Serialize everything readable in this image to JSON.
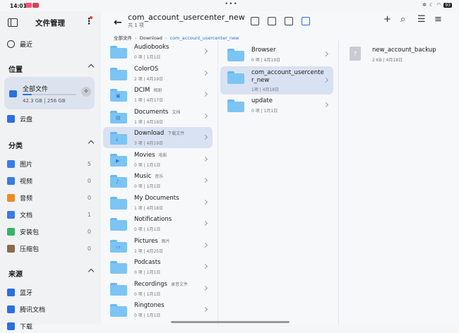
{
  "status": {
    "time": "14:01",
    "battery": "93"
  },
  "app_title": "文件管理",
  "nav": {
    "recent": "最近"
  },
  "location": {
    "heading": "位置",
    "all_files": {
      "label": "全部文件",
      "size": "42.3 GB | 256 GB",
      "used_fraction": 0.165
    },
    "cloud": "云盘"
  },
  "categories": {
    "heading": "分类",
    "items": [
      {
        "label": "图片",
        "count": "5",
        "color": "#3a7be8"
      },
      {
        "label": "视频",
        "count": "0",
        "color": "#3a7be8"
      },
      {
        "label": "音频",
        "count": "0",
        "color": "#f08a24"
      },
      {
        "label": "文档",
        "count": "1",
        "color": "#3a7be8"
      },
      {
        "label": "安装包",
        "count": "0",
        "color": "#36b46a"
      },
      {
        "label": "压缩包",
        "count": "0",
        "color": "#8b6b4a"
      }
    ]
  },
  "sources": {
    "heading": "来源",
    "items": [
      {
        "label": "蓝牙",
        "color": "#2b6fe3"
      },
      {
        "label": "腾讯文档",
        "color": "#2b6fe3"
      },
      {
        "label": "下载",
        "color": "#2b6fe3"
      }
    ]
  },
  "header": {
    "title": "com_account_usercenter_new",
    "subtitle": "共 1 项"
  },
  "breadcrumb": [
    "全部文件",
    "Download",
    "com_account_usercenter_new"
  ],
  "col1": [
    {
      "name": "Audiobooks",
      "tag": "",
      "meta": "0 项 | 1月1日",
      "glyph": ""
    },
    {
      "name": "ColorOS",
      "tag": "",
      "meta": "2 项 | 4月19日",
      "glyph": ""
    },
    {
      "name": "DCIM",
      "tag": "相册",
      "meta": "1 项 | 4月17日",
      "glyph": "▣"
    },
    {
      "name": "Documents",
      "tag": "文档",
      "meta": "1 项 | 4月18日",
      "glyph": "▤"
    },
    {
      "name": "Download",
      "tag": "下载文件",
      "meta": "3 项 | 4月19日",
      "glyph": "⤓"
    },
    {
      "name": "Movies",
      "tag": "电影",
      "meta": "0 项 | 1月1日",
      "glyph": "▶"
    },
    {
      "name": "Music",
      "tag": "音乐",
      "meta": "0 项 | 1月1日",
      "glyph": "♪"
    },
    {
      "name": "My Documents",
      "tag": "",
      "meta": "1 项 | 4月18日",
      "glyph": ""
    },
    {
      "name": "Notifications",
      "tag": "",
      "meta": "0 项 | 1月1日",
      "glyph": ""
    },
    {
      "name": "Pictures",
      "tag": "图片",
      "meta": "1 项 | 4月25日",
      "glyph": "▭"
    },
    {
      "name": "Podcasts",
      "tag": "",
      "meta": "0 项 | 1月1日",
      "glyph": ""
    },
    {
      "name": "Recordings",
      "tag": "录音文件",
      "meta": "0 项 | 1月1日",
      "glyph": ""
    },
    {
      "name": "Ringtones",
      "tag": "",
      "meta": "0 项 | 1月1日",
      "glyph": ""
    }
  ],
  "col2": [
    {
      "name": "Browser",
      "meta": "0 项 | 4月19日"
    },
    {
      "name": "com_account_usercente r_new",
      "meta": "1项 | 4月18日"
    },
    {
      "name": "update",
      "meta": "0 项 | 1月1日"
    }
  ],
  "col3": [
    {
      "name": "new_account_backup",
      "meta": "2 KB | 4月18日",
      "glyph": "?"
    }
  ]
}
